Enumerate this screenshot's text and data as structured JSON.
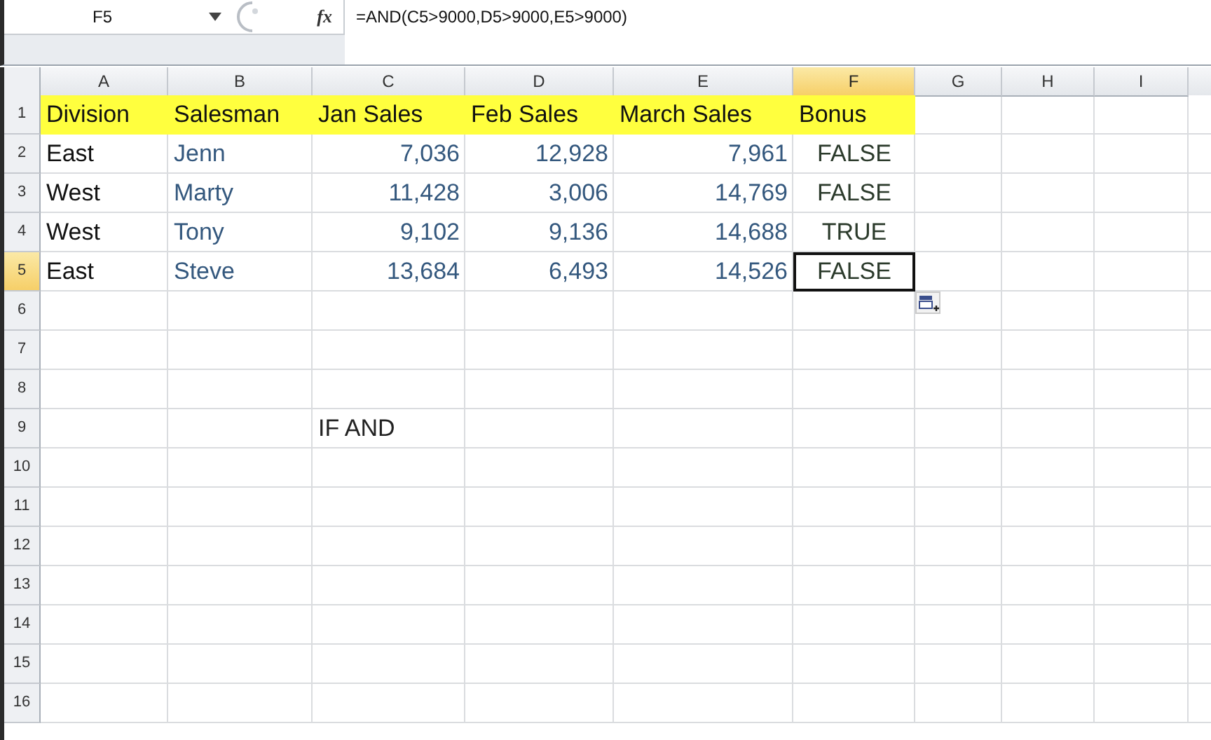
{
  "formula_bar": {
    "name_box": "F5",
    "function_label": "fx",
    "formula": "=AND(C5>9000,D5>9000,E5>9000)"
  },
  "columns": [
    {
      "label": "A",
      "selected": false
    },
    {
      "label": "B",
      "selected": false
    },
    {
      "label": "C",
      "selected": false
    },
    {
      "label": "D",
      "selected": false
    },
    {
      "label": "E",
      "selected": false
    },
    {
      "label": "F",
      "selected": true
    },
    {
      "label": "G",
      "selected": false
    },
    {
      "label": "H",
      "selected": false
    },
    {
      "label": "I",
      "selected": false
    }
  ],
  "rows": [
    {
      "number": "1",
      "selected": false,
      "kind": "header",
      "cells": {
        "A": "Division",
        "B": "Salesman",
        "C": "Jan Sales",
        "D": "Feb Sales",
        "E": "March Sales",
        "F": "Bonus"
      }
    },
    {
      "number": "2",
      "selected": false,
      "kind": "data",
      "cells": {
        "A": "East",
        "B": "Jenn",
        "C": "7,036",
        "D": "12,928",
        "E": "7,961",
        "F": "FALSE"
      }
    },
    {
      "number": "3",
      "selected": false,
      "kind": "data",
      "cells": {
        "A": "West",
        "B": "Marty",
        "C": "11,428",
        "D": "3,006",
        "E": "14,769",
        "F": "FALSE"
      }
    },
    {
      "number": "4",
      "selected": false,
      "kind": "data",
      "cells": {
        "A": "West",
        "B": "Tony",
        "C": "9,102",
        "D": "9,136",
        "E": "14,688",
        "F": "TRUE"
      }
    },
    {
      "number": "5",
      "selected": true,
      "kind": "data",
      "cells": {
        "A": "East",
        "B": "Steve",
        "C": "13,684",
        "D": "6,493",
        "E": "14,526",
        "F": "FALSE"
      }
    },
    {
      "number": "6",
      "selected": false,
      "kind": "empty",
      "cells": {}
    },
    {
      "number": "7",
      "selected": false,
      "kind": "empty",
      "cells": {}
    },
    {
      "number": "8",
      "selected": false,
      "kind": "empty",
      "cells": {}
    },
    {
      "number": "9",
      "selected": false,
      "kind": "note",
      "cells": {
        "C": "IF AND"
      }
    },
    {
      "number": "10",
      "selected": false,
      "kind": "empty",
      "cells": {}
    },
    {
      "number": "11",
      "selected": false,
      "kind": "empty",
      "cells": {}
    },
    {
      "number": "12",
      "selected": false,
      "kind": "empty",
      "cells": {}
    },
    {
      "number": "13",
      "selected": false,
      "kind": "empty",
      "cells": {}
    },
    {
      "number": "14",
      "selected": false,
      "kind": "empty",
      "cells": {}
    },
    {
      "number": "15",
      "selected": false,
      "kind": "empty",
      "cells": {}
    },
    {
      "number": "16",
      "selected": false,
      "kind": "empty",
      "cells": {}
    }
  ]
}
